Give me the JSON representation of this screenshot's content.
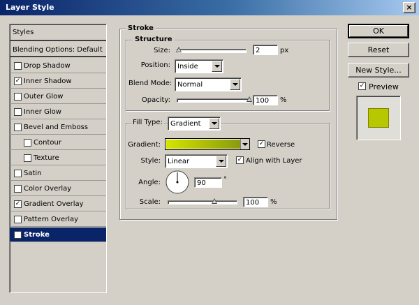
{
  "window": {
    "title": "Layer Style",
    "close_label": "×"
  },
  "sidebar": {
    "header": "Styles",
    "items": [
      {
        "label": "Blending Options: Default",
        "checkbox": false,
        "checked": false,
        "indent": false,
        "selected": false
      },
      {
        "label": "Drop Shadow",
        "checkbox": true,
        "checked": false,
        "indent": false,
        "selected": false
      },
      {
        "label": "Inner Shadow",
        "checkbox": true,
        "checked": true,
        "indent": false,
        "selected": false
      },
      {
        "label": "Outer Glow",
        "checkbox": true,
        "checked": false,
        "indent": false,
        "selected": false
      },
      {
        "label": "Inner Glow",
        "checkbox": true,
        "checked": false,
        "indent": false,
        "selected": false
      },
      {
        "label": "Bevel and Emboss",
        "checkbox": true,
        "checked": false,
        "indent": false,
        "selected": false
      },
      {
        "label": "Contour",
        "checkbox": true,
        "checked": false,
        "indent": true,
        "selected": false
      },
      {
        "label": "Texture",
        "checkbox": true,
        "checked": false,
        "indent": true,
        "selected": false
      },
      {
        "label": "Satin",
        "checkbox": true,
        "checked": false,
        "indent": false,
        "selected": false
      },
      {
        "label": "Color Overlay",
        "checkbox": true,
        "checked": false,
        "indent": false,
        "selected": false
      },
      {
        "label": "Gradient Overlay",
        "checkbox": true,
        "checked": true,
        "indent": false,
        "selected": false
      },
      {
        "label": "Pattern Overlay",
        "checkbox": true,
        "checked": false,
        "indent": false,
        "selected": false
      },
      {
        "label": "Stroke",
        "checkbox": true,
        "checked": true,
        "indent": false,
        "selected": true
      }
    ]
  },
  "stroke": {
    "title": "Stroke",
    "structure": {
      "title": "Structure",
      "size_label": "Size:",
      "size_value": "2",
      "size_unit": "px",
      "size_fraction": 0.02,
      "position_label": "Position:",
      "position_value": "Inside",
      "blend_mode_label": "Blend Mode:",
      "blend_mode_value": "Normal",
      "opacity_label": "Opacity:",
      "opacity_value": "100",
      "opacity_unit": "%",
      "opacity_fraction": 1.0
    },
    "fill": {
      "fill_type_label": "Fill Type:",
      "fill_type_value": "Gradient",
      "gradient_label": "Gradient:",
      "gradient_colors": [
        "#d4e400",
        "#8a9a10"
      ],
      "reverse_label": "Reverse",
      "reverse_checked": true,
      "style_label": "Style:",
      "style_value": "Linear",
      "align_label": "Align with Layer",
      "align_checked": true,
      "angle_label": "Angle:",
      "angle_value": "90",
      "angle_unit": "°",
      "scale_label": "Scale:",
      "scale_value": "100",
      "scale_unit": "%",
      "scale_fraction": 0.67
    }
  },
  "buttons": {
    "ok": "OK",
    "reset": "Reset",
    "new_style": "New Style..."
  },
  "preview": {
    "label": "Preview",
    "checked": true,
    "swatch_color": "#b8c800"
  },
  "colors": {
    "selection": "#0a246a",
    "title_bar": "#0a246a"
  }
}
